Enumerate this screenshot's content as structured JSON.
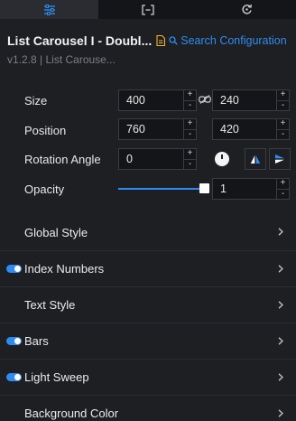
{
  "tabs": [
    {
      "icon": "sliders-icon"
    },
    {
      "icon": "bracket-frame-icon"
    },
    {
      "icon": "refresh-icon"
    }
  ],
  "header": {
    "title": "List Carousel I - Doubl...",
    "search_label": "Search Configuration",
    "version": "v1.2.8 | List Carouse..."
  },
  "properties": {
    "size": {
      "label": "Size",
      "width": "400",
      "height": "240"
    },
    "position": {
      "label": "Position",
      "x": "760",
      "y": "420"
    },
    "rotation": {
      "label": "Rotation Angle",
      "value": "0"
    },
    "opacity": {
      "label": "Opacity",
      "value": "1",
      "slider_level": 1
    }
  },
  "stepper": {
    "plus": "+",
    "minus": "-"
  },
  "sections": [
    {
      "label": "Global Style",
      "toggle": false
    },
    {
      "label": "Index Numbers",
      "toggle": true
    },
    {
      "label": "Text Style",
      "toggle": false
    },
    {
      "label": "Bars",
      "toggle": true
    },
    {
      "label": "Light Sweep",
      "toggle": true
    },
    {
      "label": "Background Color",
      "toggle": false
    }
  ],
  "colors": {
    "accent": "#2e8cf0",
    "background": "#1e1f23",
    "doc_icon": "#f0b429"
  }
}
